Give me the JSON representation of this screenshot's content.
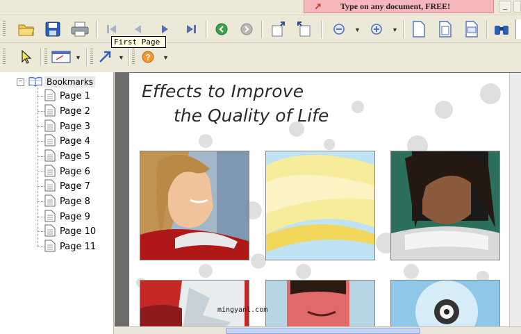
{
  "banner": {
    "text": "Type on any document, FREE!"
  },
  "window_controls": {
    "minimize": "_"
  },
  "toolbar1": {
    "buttons": [
      "open",
      "save",
      "print",
      "first-page",
      "previous-page",
      "next-page",
      "last-page",
      "go-back",
      "go-forward",
      "rotate-counterclockwise",
      "rotate-clockwise",
      "zoom-out",
      "zoom-in",
      "actual-size",
      "fit-page",
      "fit-width",
      "find"
    ]
  },
  "toolbar2": {
    "buttons": [
      "select-tool",
      "annotation-tool",
      "link-tool",
      "help"
    ]
  },
  "tooltip": {
    "text": "First Page"
  },
  "bookmarks": {
    "root_label": "Bookmarks",
    "expander": "−",
    "items": [
      "Page 1",
      "Page 2",
      "Page 3",
      "Page 4",
      "Page 5",
      "Page 6",
      "Page 7",
      "Page 8",
      "Page 9",
      "Page 10",
      "Page 11"
    ]
  },
  "document": {
    "title_line1": "Effects to Improve",
    "title_line2": "the Quality of Life",
    "watermark": "mingyanl.com"
  }
}
